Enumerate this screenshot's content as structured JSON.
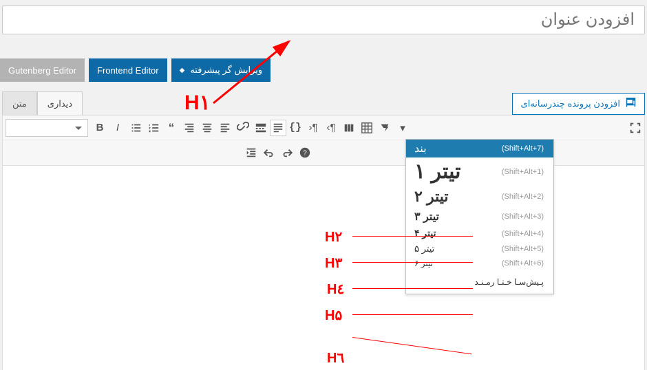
{
  "title_placeholder": "افزودن عنوان",
  "editor_buttons": {
    "gutenberg": "Gutenberg Editor",
    "frontend": "Frontend Editor",
    "advanced": "ویرایش گر پیشرفته"
  },
  "media_button": "افزودن پرونده چندرسانه‌ای",
  "tabs": {
    "visual": "دیداری",
    "text": "متن"
  },
  "format_dropdown": {
    "paragraph": {
      "label": "بند",
      "shortcut": "(Shift+Alt+7)"
    },
    "h1": {
      "label": "تیتر ۱",
      "shortcut": "(Shift+Alt+1)"
    },
    "h2": {
      "label": "تیتر ۲",
      "shortcut": "(Shift+Alt+2)"
    },
    "h3": {
      "label": "تیتر ۳",
      "shortcut": "(Shift+Alt+3)"
    },
    "h4": {
      "label": "تیتر ۴",
      "shortcut": "(Shift+Alt+4)"
    },
    "h5": {
      "label": "تیتر ۵",
      "shortcut": "(Shift+Alt+5)"
    },
    "h6": {
      "label": "تیتر ۶",
      "shortcut": "(Shift+Alt+6)"
    },
    "pre": {
      "label": "پـیش‌سـا خـتـا رمـنـد"
    }
  },
  "annotations": {
    "h1": "H۱",
    "h2": "H۲",
    "h3": "H۳",
    "h4": "H٤",
    "h5": "H۵",
    "h6": "H٦"
  }
}
